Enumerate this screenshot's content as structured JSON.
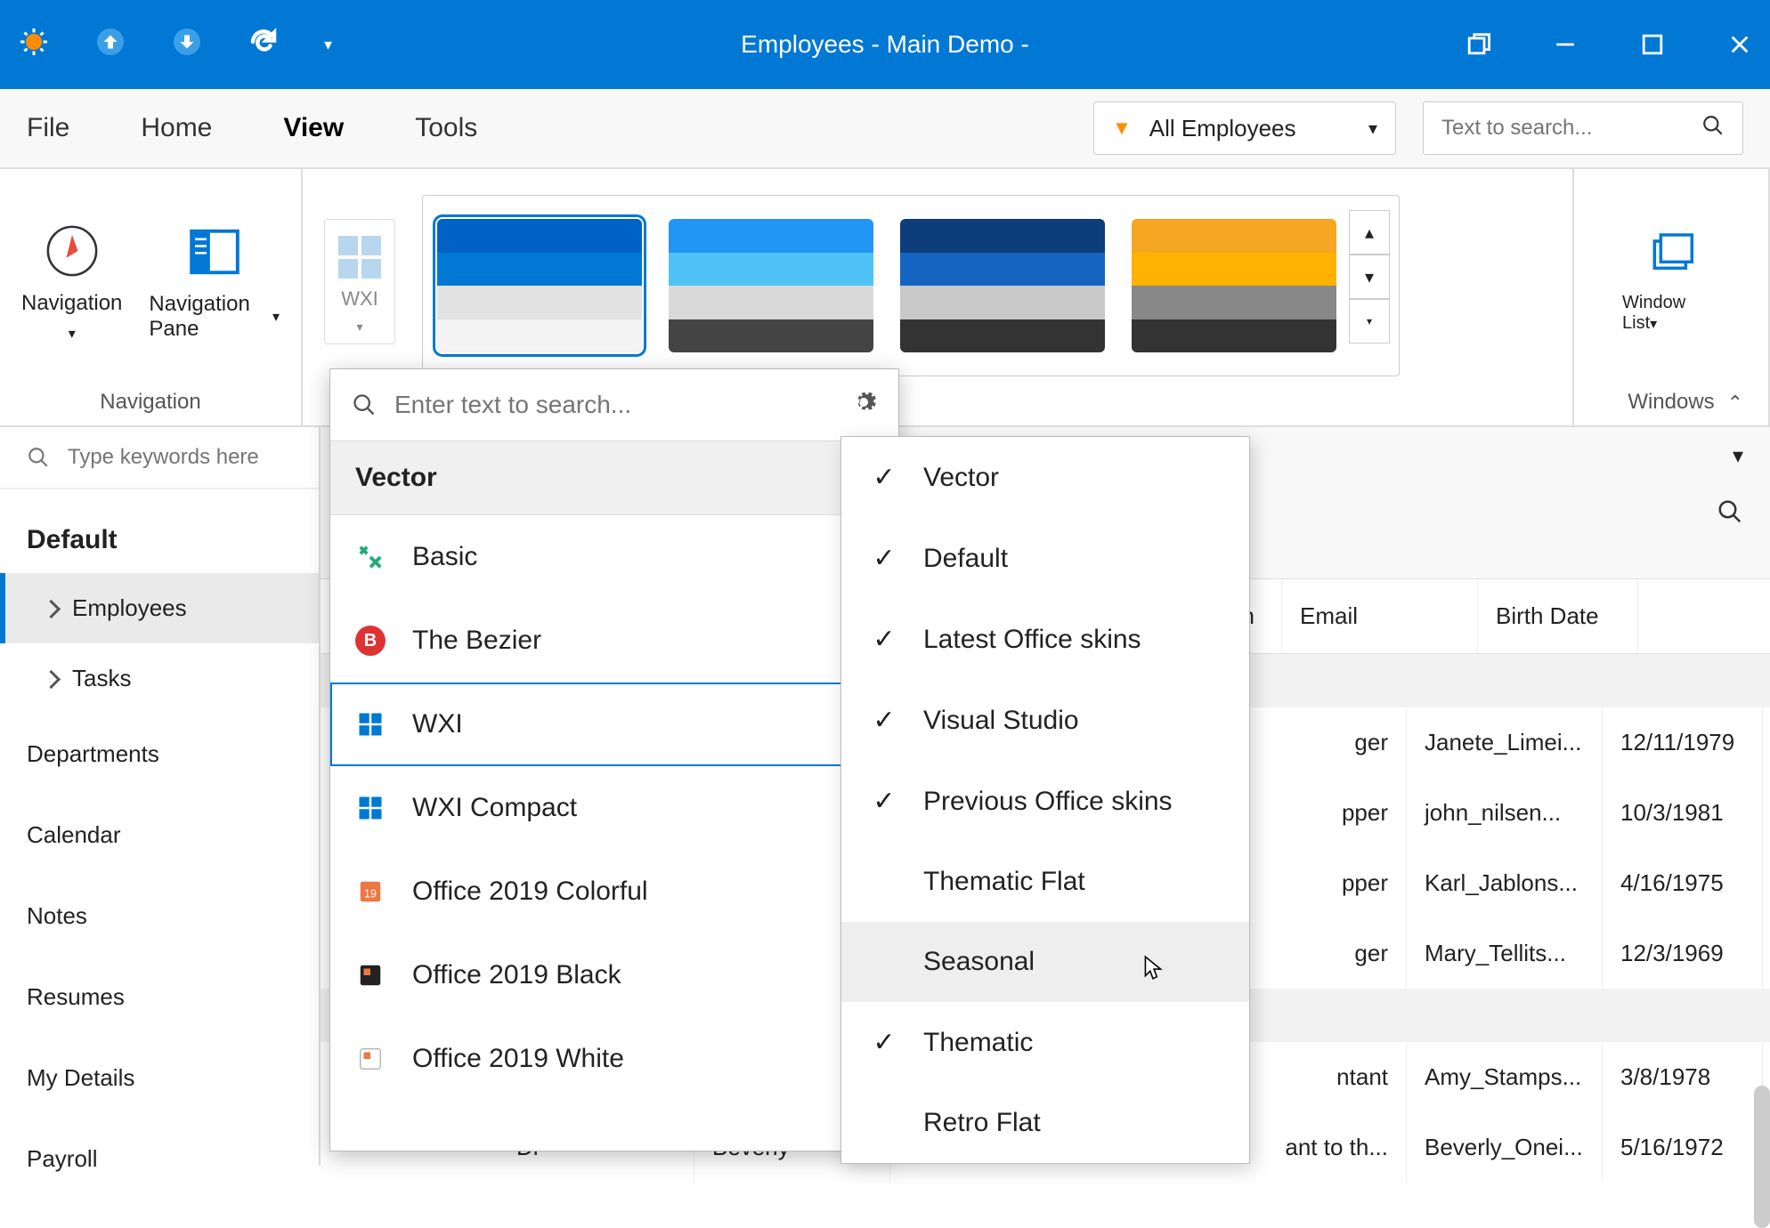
{
  "window": {
    "title": "Employees - Main Demo -"
  },
  "menu": {
    "file": "File",
    "home": "Home",
    "view": "View",
    "tools": "Tools",
    "filter": "All Employees",
    "search_placeholder": "Text to search..."
  },
  "ribbon": {
    "navigation": "Navigation",
    "nav_pane": "Navigation Pane",
    "nav_group_label": "Navigation",
    "wxi": "WXI",
    "window_list": "Window List",
    "windows_label": "Windows"
  },
  "sidebar": {
    "search_placeholder": "Type keywords here",
    "tree_title": "Default",
    "employees": "Employees",
    "tasks": "Tasks",
    "departments": "Departments",
    "calendar": "Calendar",
    "notes": "Notes",
    "resumes": "Resumes",
    "my_details": "My Details",
    "payroll": "Payroll"
  },
  "grid": {
    "headers": {
      "title": "",
      "first_name": "",
      "position": "on",
      "email": "Email",
      "birth_date": "Birth Date"
    },
    "rows": [
      {
        "title": "",
        "first_name": "",
        "position": "ger",
        "email": "Janete_Limei...",
        "birth_date": "12/11/1979"
      },
      {
        "title": "",
        "first_name": "",
        "position": "pper",
        "email": "john_nilsen...",
        "birth_date": "10/3/1981"
      },
      {
        "title": "",
        "first_name": "",
        "position": "pper",
        "email": "Karl_Jablons...",
        "birth_date": "4/16/1975"
      },
      {
        "title": "",
        "first_name": "",
        "position": "ger",
        "email": "Mary_Tellits...",
        "birth_date": "12/3/1969"
      }
    ],
    "rows2": [
      {
        "title": "",
        "first_name": "",
        "position": "ntant",
        "email": "Amy_Stamps...",
        "birth_date": "3/8/1978"
      },
      {
        "title": "Dr",
        "first_name": "Beverly",
        "position": "ant to th...",
        "email": "Beverly_Onei...",
        "birth_date": "5/16/1972"
      }
    ]
  },
  "skin_popup": {
    "search_placeholder": "Enter text to search...",
    "vector_label": "Vector",
    "items": {
      "basic": "Basic",
      "bezier": "The Bezier",
      "wxi": "WXI",
      "wxi_compact": "WXI Compact",
      "off2019c": "Office 2019 Colorful",
      "off2019b": "Office 2019 Black",
      "off2019w": "Office 2019 White"
    }
  },
  "cat_popup": {
    "vector": "Vector",
    "default": "Default",
    "latest_office": "Latest Office skins",
    "visual_studio": "Visual Studio",
    "previous_office": "Previous Office skins",
    "thematic_flat": "Thematic Flat",
    "seasonal": "Seasonal",
    "thematic": "Thematic",
    "retro_flat": "Retro Flat"
  }
}
